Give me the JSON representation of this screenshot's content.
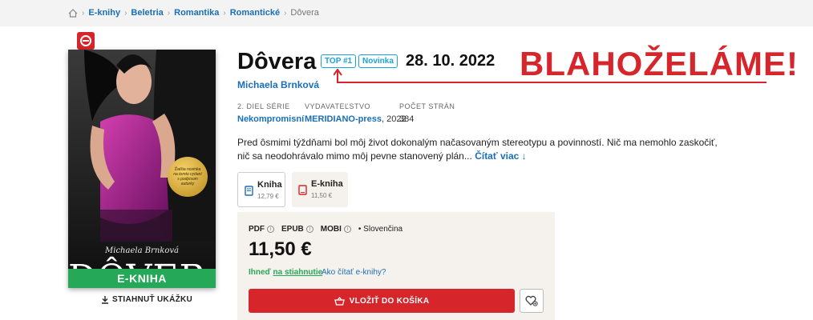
{
  "breadcrumb": {
    "items": [
      "E-knihy",
      "Beletria",
      "Romantika",
      "Romantické"
    ],
    "current": "Dôvera"
  },
  "product": {
    "title": "Dôvera",
    "tags": [
      "TOP #1",
      "Novinka"
    ],
    "release_date": "28. 10. 2022",
    "author": "Michaela Brnková",
    "series_label": "2. DIEL SÉRIE",
    "series_value": "Nekompromisní",
    "publisher_label": "VYDAVATEĽSTVO",
    "publisher_value": "MERIDIANO-press",
    "publisher_year": ", 2022",
    "pages_label": "POČET STRÁN",
    "pages_value": "384",
    "description": "Pred ôsmimi týždňami bol môj život dokonalým načasovaným stereotypu a povinností. Nič ma nemohlo zaskočiť, nič sa neodohrávalo mimo môj pevne stanovený plán...",
    "read_more": "Čítať viac ↓"
  },
  "cover": {
    "author": "Michaela Brnková",
    "title": "DÔVERA",
    "strip": "E-KNIHA",
    "seal_text": "Ďalšia novinka na tomto vydaní s podpisom autorky",
    "download_label": "STIAHNUŤ UKÁŽKU"
  },
  "formats": [
    {
      "label": "Kniha",
      "price": "12,79 €",
      "icon": "book-icon"
    },
    {
      "label": "E-kniha",
      "price": "11,50 €",
      "icon": "tablet-icon"
    }
  ],
  "purchase": {
    "file_formats": [
      "PDF",
      "EPUB",
      "MOBI"
    ],
    "language": "• Slovenčina",
    "price": "11,50 €",
    "availability_prefix": "Ihneď",
    "availability_link": "na stiahnutie",
    "how_to_read": "Ako čítať e-knihy?",
    "cart_label": "VLOŽIŤ DO KOŠÍKA"
  },
  "overlay": {
    "congrats": "BLAHOŽELÁME!"
  },
  "colors": {
    "accent_red": "#d6262b",
    "link_blue": "#1a6fb8",
    "green": "#25a857",
    "tag_blue": "#1aa3d8"
  }
}
